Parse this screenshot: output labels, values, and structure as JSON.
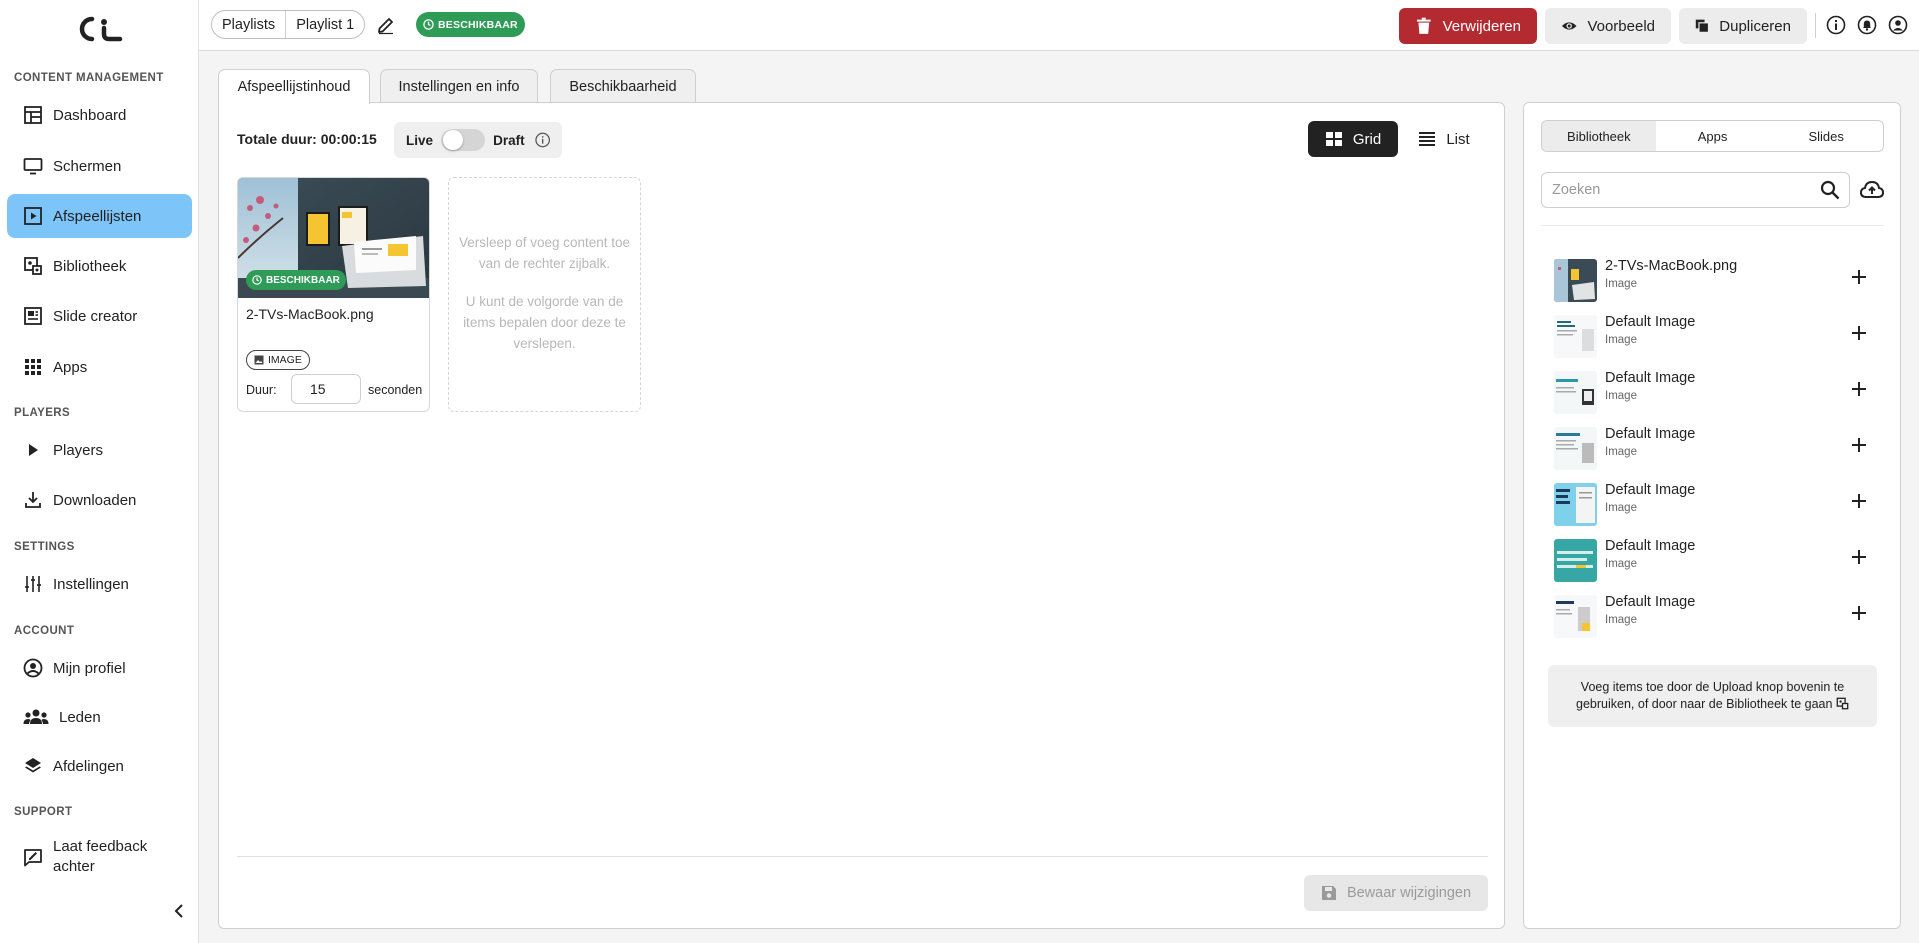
{
  "sidebar": {
    "sections": {
      "content": "CONTENT MANAGEMENT",
      "players": "PLAYERS",
      "settings": "SETTINGS",
      "account": "ACCOUNT",
      "support": "SUPPORT"
    },
    "items": {
      "dashboard": "Dashboard",
      "schermen": "Schermen",
      "afspeellijsten": "Afspeellijsten",
      "bibliotheek": "Bibliotheek",
      "slide_creator": "Slide creator",
      "apps": "Apps",
      "players": "Players",
      "downloaden": "Downloaden",
      "instellingen": "Instellingen",
      "mijn_profiel": "Mijn profiel",
      "leden": "Leden",
      "afdelingen": "Afdelingen",
      "feedback_line1": "Laat feedback",
      "feedback_line2": "achter"
    },
    "active": "afspeellijsten",
    "active_color": "#7dc5f9"
  },
  "header": {
    "breadcrumb": [
      "Playlists",
      "Playlist 1"
    ],
    "status_badge": "BESCHIKBAAR",
    "buttons": {
      "delete": "Verwijderen",
      "preview": "Voorbeeld",
      "duplicate": "Dupliceren"
    },
    "icons": [
      "info-icon",
      "bell-icon",
      "user-icon"
    ],
    "colors": {
      "delete": "#b32a31",
      "badge": "#2e9c56"
    }
  },
  "tabs": [
    "Afspeellijstinhoud",
    "Instellingen en info",
    "Beschikbaarheid"
  ],
  "main": {
    "total_duration": "Totale duur: 00:00:15",
    "toggle": {
      "left": "Live",
      "right": "Draft",
      "state": "off"
    },
    "view": {
      "grid": "Grid",
      "list": "List",
      "selected": "grid"
    },
    "card": {
      "badge": "BESCHIKBAAR",
      "title": "2-TVs-MacBook.png",
      "type": "IMAGE",
      "duration_label": "Duur:",
      "duration_value": "15",
      "duration_unit": "seconden"
    },
    "dropzone": {
      "line1": "Versleep of voeg content toe van de rechter zijbalk.",
      "line2": "U kunt de volgorde van de items bepalen door deze te verslepen."
    },
    "save_button": "Bewaar wijzigingen"
  },
  "library": {
    "tabs": [
      "Bibliotheek",
      "Apps",
      "Slides"
    ],
    "active_tab": "Bibliotheek",
    "search_placeholder": "Zoeken",
    "items": [
      {
        "name": "2-TVs-MacBook.png",
        "type": "Image"
      },
      {
        "name": "Default Image",
        "type": "Image"
      },
      {
        "name": "Default Image",
        "type": "Image"
      },
      {
        "name": "Default Image",
        "type": "Image"
      },
      {
        "name": "Default Image",
        "type": "Image"
      },
      {
        "name": "Default Image",
        "type": "Image"
      },
      {
        "name": "Default Image",
        "type": "Image"
      }
    ],
    "hint": "Voeg items toe door de Upload knop bovenin te gebruiken, of door naar de Bibliotheek te gaan"
  }
}
